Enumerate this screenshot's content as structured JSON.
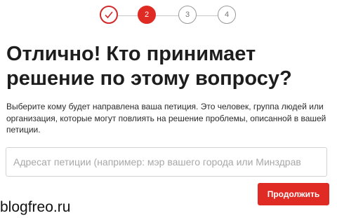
{
  "stepper": {
    "steps": [
      {
        "label": "",
        "state": "done",
        "icon": "check-icon"
      },
      {
        "label": "2",
        "state": "active"
      },
      {
        "label": "3",
        "state": "todo"
      },
      {
        "label": "4",
        "state": "todo"
      }
    ],
    "accent_color": "#e02a24"
  },
  "heading": {
    "line1": "Отлично! Кто принимает",
    "line2": "решение по этому вопросу?"
  },
  "description": "Выберите кому будет направлена ваша петиция. Это человек, группа людей или организация, которые могут повлиять на решение проблемы, описанной в вашей петиции.",
  "addressee_input": {
    "value": "",
    "placeholder": "Адресат петиции (например: мэр вашего города или Минздрав"
  },
  "continue_button": {
    "label": "Продолжить",
    "color": "#e02a24"
  },
  "watermark": {
    "text": "blogfreo.ru"
  }
}
